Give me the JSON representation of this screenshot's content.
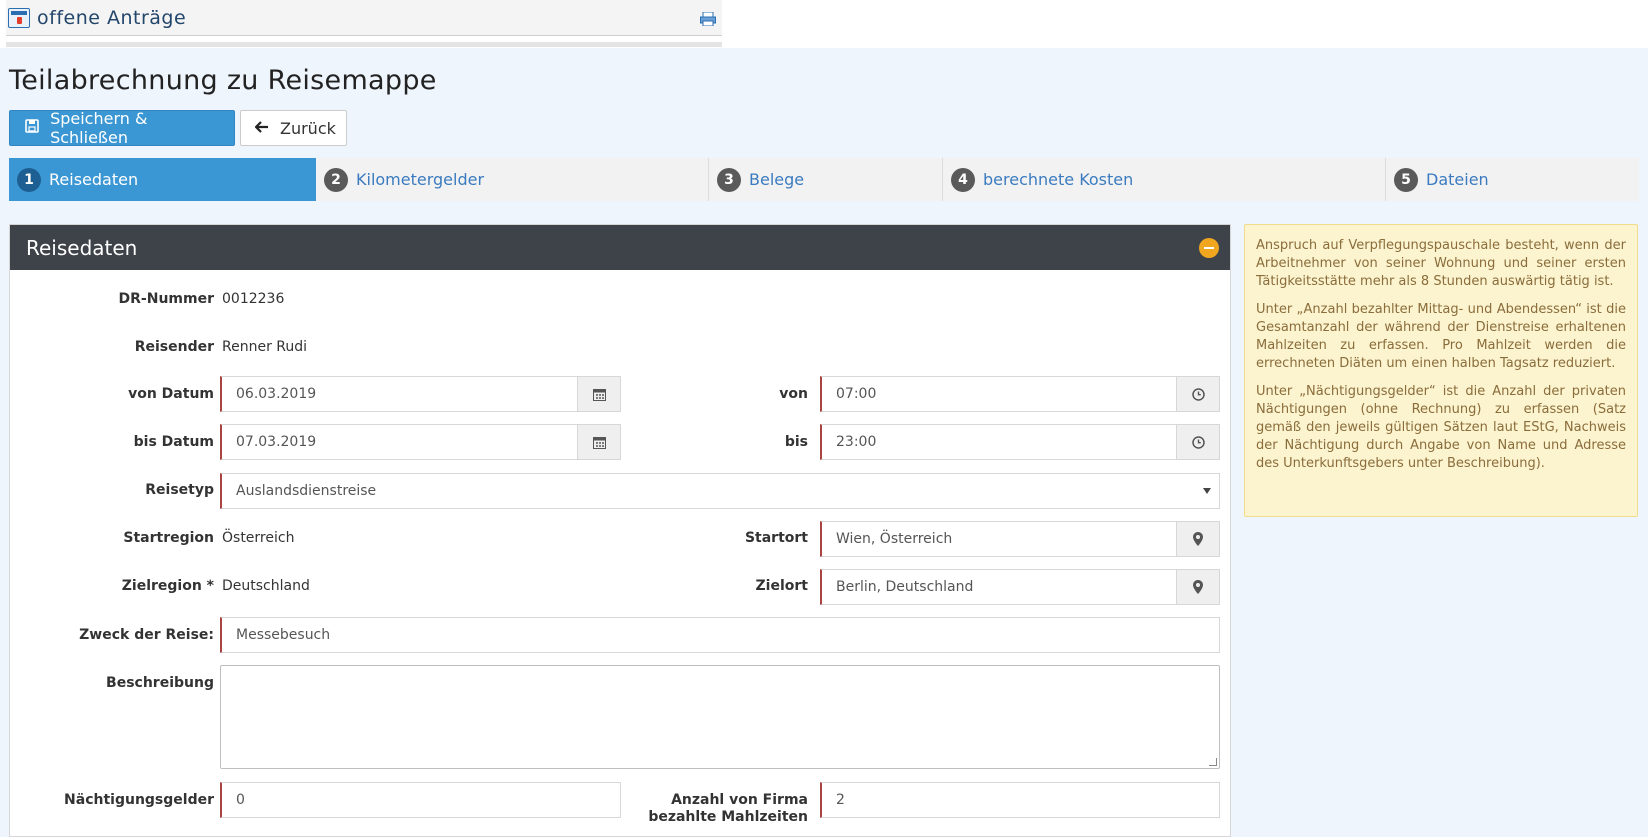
{
  "window": {
    "title": "offene Anträge"
  },
  "page": {
    "title": "Teilabrechnung zu Reisemappe"
  },
  "toolbar": {
    "save_label": "Speichern & Schließen",
    "back_label": "Zurück"
  },
  "steps": [
    {
      "num": "1",
      "label": "Reisedaten"
    },
    {
      "num": "2",
      "label": "Kilometergelder"
    },
    {
      "num": "3",
      "label": "Belege"
    },
    {
      "num": "4",
      "label": "berechnete Kosten"
    },
    {
      "num": "5",
      "label": "Dateien"
    }
  ],
  "panel": {
    "title": "Reisedaten"
  },
  "form": {
    "dr_label": "DR-Nummer",
    "dr_value": "0012236",
    "reisender_label": "Reisender",
    "reisender_value": "Renner Rudi",
    "von_datum_label": "von Datum",
    "von_datum_value": "06.03.2019",
    "von_label": "von",
    "von_value": "07:00",
    "bis_datum_label": "bis Datum",
    "bis_datum_value": "07.03.2019",
    "bis_label": "bis",
    "bis_value": "23:00",
    "reisetyp_label": "Reisetyp",
    "reisetyp_value": "Auslandsdienstreise",
    "startregion_label": "Startregion",
    "startregion_value": "Österreich",
    "startort_label": "Startort",
    "startort_value": "Wien, Österreich",
    "zielregion_label": "Zielregion *",
    "zielregion_value": "Deutschland",
    "zielort_label": "Zielort",
    "zielort_value": "Berlin, Deutschland",
    "zweck_label": "Zweck der Reise:",
    "zweck_value": "Messebesuch",
    "beschreibung_label": "Beschreibung",
    "beschreibung_value": "",
    "naechtigung_label": "Nächtigungsgelder",
    "naechtigung_value": "0",
    "mahlzeiten_label_1": "Anzahl von Firma",
    "mahlzeiten_label_2": "bezahlte Mahlzeiten",
    "mahlzeiten_value": "2"
  },
  "info": {
    "p1": "Anspruch auf Verpflegungspauschale besteht, wenn der Arbeitnehmer von seiner Wohnung und seiner ersten Tätigkeitsstätte mehr als 8 Stunden auswärtig tätig ist.",
    "p2": "Unter „Anzahl bezahlter Mittag- und Abendessen“ ist die Gesamtanzahl der während der Dienstreise erhaltenen Mahlzeiten zu erfassen. Pro Mahlzeit werden die errechneten Diäten um einen halben Tagsatz reduziert.",
    "p3": "Unter „Nächtigungsgelder“ ist die Anzahl der privaten Nächtigungen (ohne Rechnung) zu erfassen (Satz gemäß den jeweils gültigen Sätzen laut EStG, Nachweis der Nächtigung durch Angabe von Name und Adresse des Unterkunftsgebers unter Beschreibung)."
  }
}
